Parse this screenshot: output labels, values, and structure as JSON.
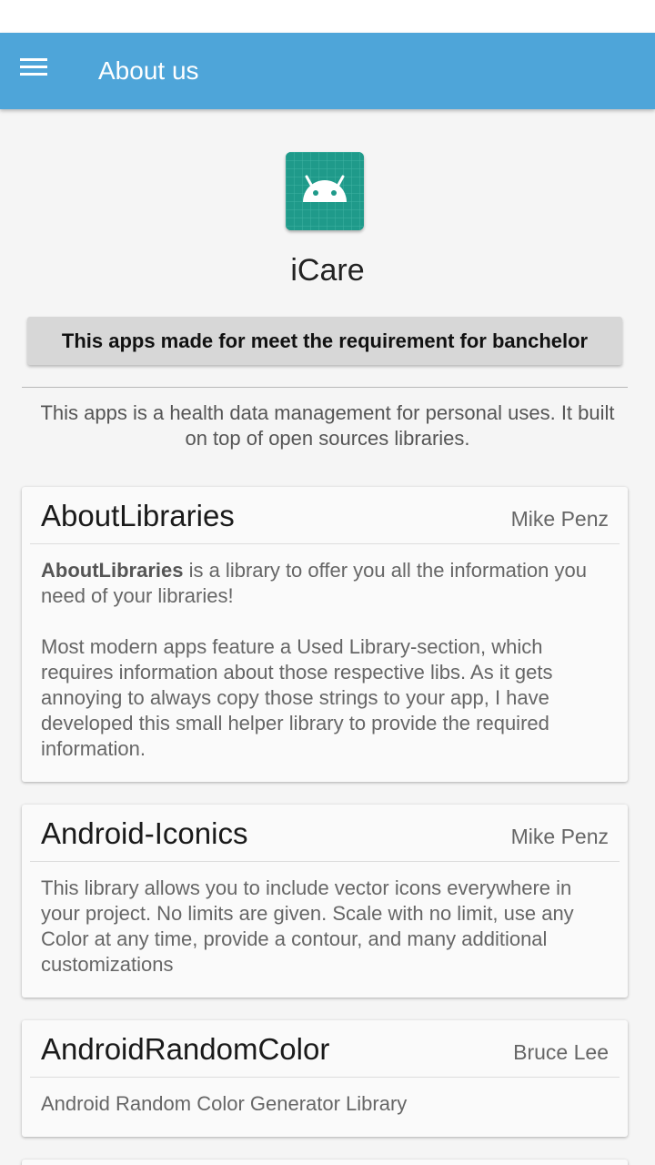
{
  "toolbar": {
    "title": "About us",
    "menu_icon": "hamburger-menu-icon",
    "color": "#4ea5d9"
  },
  "app": {
    "name": "iCare",
    "icon": "android-robot-icon",
    "icon_color": "#1f9a8a",
    "button_label": "This apps made for meet the requirement for banchelor",
    "description": "This apps is a health data management for personal uses. It built on top of open sources libraries."
  },
  "libraries": [
    {
      "name": "AboutLibraries",
      "author": "Mike Penz",
      "desc_bold": "AboutLibraries",
      "desc_rest": " is a library to offer you all the information you need of your libraries!",
      "desc_extra": "Most modern apps feature a Used Library-section, which requires information about those respective libs. As it gets annoying to always copy those strings to your app, I have developed this small helper library to provide the required information."
    },
    {
      "name": "Android-Iconics",
      "author": "Mike Penz",
      "description": "This library allows you to include vector icons everywhere in your project. No limits are given. Scale with no limit, use any Color at any time, provide a contour, and many additional customizations"
    },
    {
      "name": "AndroidRandomColor",
      "author": "Bruce Lee",
      "description": "Android Random Color Generator Library"
    }
  ]
}
